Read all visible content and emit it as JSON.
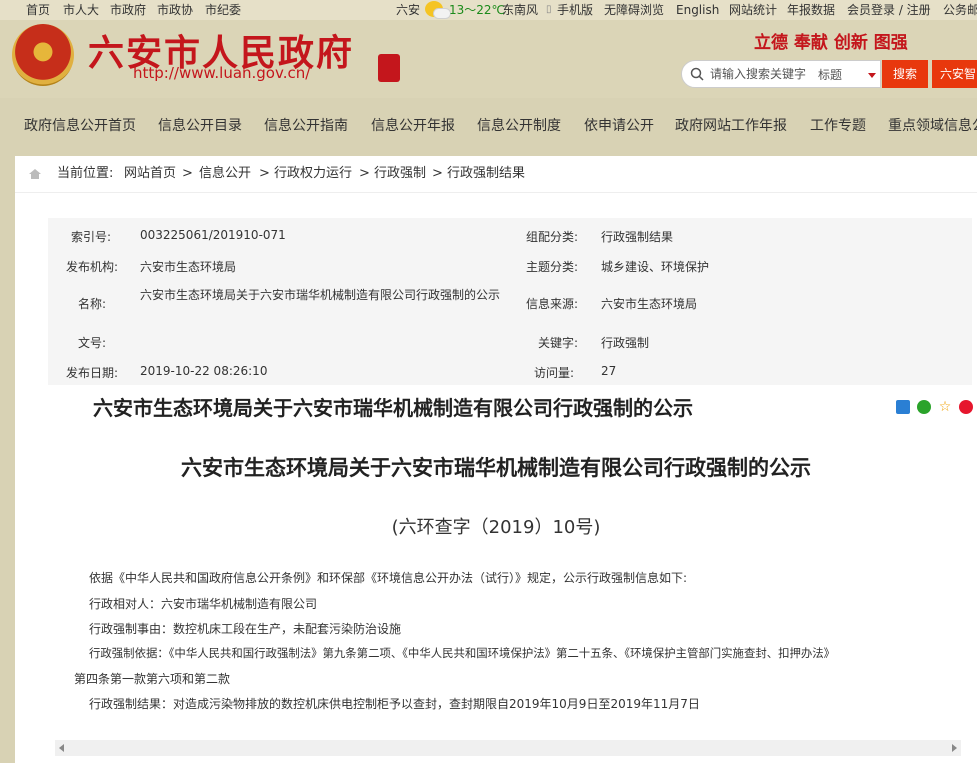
{
  "topbar": {
    "links": [
      "首页",
      "市人大",
      "市政府",
      "市政协",
      "市纪委"
    ],
    "city": "六安",
    "temperature": "13～22℃",
    "wind": "东南风",
    "right_links": [
      "手机版",
      "无障碍浏览",
      "English",
      "网站统计",
      "年报数据",
      "会员登录 / 注册",
      "公务邮"
    ]
  },
  "header": {
    "site_name": "六安市人民政府",
    "site_url": "http://www.luan.gov.cn/",
    "slogan": "立德 奉献 创新 图强",
    "search": {
      "placeholder": "请输入搜索关键字",
      "scope": "标题",
      "button": "搜索"
    },
    "ai_button": "六安智"
  },
  "nav": [
    "政府信息公开首页",
    "信息公开目录",
    "信息公开指南",
    "信息公开年报",
    "信息公开制度",
    "依申请公开",
    "政府网站工作年报",
    "工作专题",
    "重点领域信息公"
  ],
  "breadcrumb": {
    "label": "当前位置:",
    "items": [
      "网站首页",
      "信息公开",
      "行政权力运行",
      "行政强制",
      "行政强制结果"
    ],
    "separator": ">"
  },
  "meta": {
    "index_no_label": "索引号:",
    "index_no": "003225061/201910-071",
    "category_label": "组配分类:",
    "category": "行政强制结果",
    "publisher_label": "发布机构:",
    "publisher": "六安市生态环境局",
    "topic_label": "主题分类:",
    "topic": "城乡建设、环境保护",
    "name_label": "名称:",
    "name": "六安市生态环境局关于六安市瑞华机械制造有限公司行政强制的公示",
    "source_label": "信息来源:",
    "source": "六安市生态环境局",
    "doc_no_label": "文号:",
    "doc_no": "",
    "keyword_label": "关键字:",
    "keyword": "行政强制",
    "date_label": "发布日期:",
    "date": "2019-10-22 08:26:10",
    "views_label": "访问量:",
    "views": "27"
  },
  "article": {
    "title": "六安市生态环境局关于六安市瑞华机械制造有限公司行政强制的公示",
    "heading": "六安市生态环境局关于六安市瑞华机械制造有限公司行政强制的公示",
    "doc_number": "(六环查字（2019）10号)",
    "paragraphs": [
      "依据《中华人民共和国政府信息公开条例》和环保部《环境信息公开办法（试行）》规定，公示行政强制信息如下:",
      "行政相对人：六安市瑞华机械制造有限公司",
      "行政强制事由：数控机床工段在生产，未配套污染防治设施",
      "行政强制依据：《中华人民共和国行政强制法》第九条第二项、《中华人民共和国环境保护法》第二十五条、《环境保护主管部门实施查封、扣押办法》",
      "第四条第一款第六项和第二款",
      "行政强制结果：对造成污染物排放的数控机床供电控制柜予以查封，查封期限自2019年10月9日至2019年11月7日"
    ]
  },
  "colors": {
    "brand_red": "#c4161c",
    "search_orange": "#e8380d",
    "page_bg": "#d8d2b4"
  }
}
